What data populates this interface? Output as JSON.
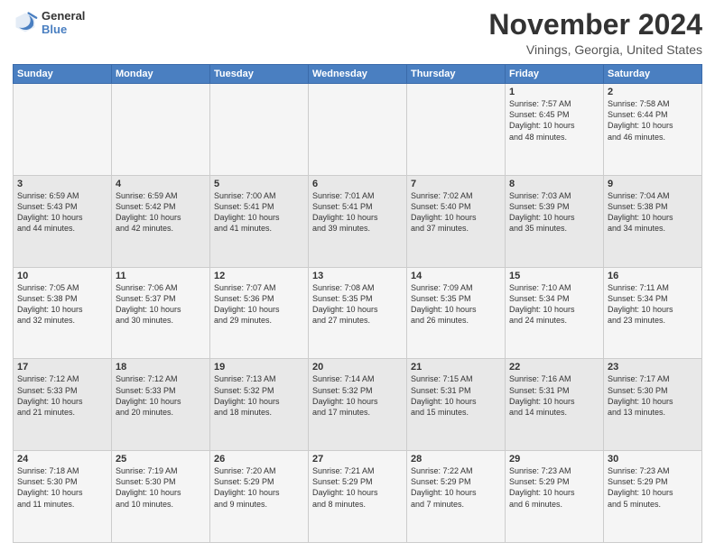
{
  "header": {
    "logo_general": "General",
    "logo_blue": "Blue",
    "month": "November 2024",
    "location": "Vinings, Georgia, United States"
  },
  "days_of_week": [
    "Sunday",
    "Monday",
    "Tuesday",
    "Wednesday",
    "Thursday",
    "Friday",
    "Saturday"
  ],
  "weeks": [
    [
      {
        "day": "",
        "info": ""
      },
      {
        "day": "",
        "info": ""
      },
      {
        "day": "",
        "info": ""
      },
      {
        "day": "",
        "info": ""
      },
      {
        "day": "",
        "info": ""
      },
      {
        "day": "1",
        "info": "Sunrise: 7:57 AM\nSunset: 6:45 PM\nDaylight: 10 hours\nand 48 minutes."
      },
      {
        "day": "2",
        "info": "Sunrise: 7:58 AM\nSunset: 6:44 PM\nDaylight: 10 hours\nand 46 minutes."
      }
    ],
    [
      {
        "day": "3",
        "info": "Sunrise: 6:59 AM\nSunset: 5:43 PM\nDaylight: 10 hours\nand 44 minutes."
      },
      {
        "day": "4",
        "info": "Sunrise: 6:59 AM\nSunset: 5:42 PM\nDaylight: 10 hours\nand 42 minutes."
      },
      {
        "day": "5",
        "info": "Sunrise: 7:00 AM\nSunset: 5:41 PM\nDaylight: 10 hours\nand 41 minutes."
      },
      {
        "day": "6",
        "info": "Sunrise: 7:01 AM\nSunset: 5:41 PM\nDaylight: 10 hours\nand 39 minutes."
      },
      {
        "day": "7",
        "info": "Sunrise: 7:02 AM\nSunset: 5:40 PM\nDaylight: 10 hours\nand 37 minutes."
      },
      {
        "day": "8",
        "info": "Sunrise: 7:03 AM\nSunset: 5:39 PM\nDaylight: 10 hours\nand 35 minutes."
      },
      {
        "day": "9",
        "info": "Sunrise: 7:04 AM\nSunset: 5:38 PM\nDaylight: 10 hours\nand 34 minutes."
      }
    ],
    [
      {
        "day": "10",
        "info": "Sunrise: 7:05 AM\nSunset: 5:38 PM\nDaylight: 10 hours\nand 32 minutes."
      },
      {
        "day": "11",
        "info": "Sunrise: 7:06 AM\nSunset: 5:37 PM\nDaylight: 10 hours\nand 30 minutes."
      },
      {
        "day": "12",
        "info": "Sunrise: 7:07 AM\nSunset: 5:36 PM\nDaylight: 10 hours\nand 29 minutes."
      },
      {
        "day": "13",
        "info": "Sunrise: 7:08 AM\nSunset: 5:35 PM\nDaylight: 10 hours\nand 27 minutes."
      },
      {
        "day": "14",
        "info": "Sunrise: 7:09 AM\nSunset: 5:35 PM\nDaylight: 10 hours\nand 26 minutes."
      },
      {
        "day": "15",
        "info": "Sunrise: 7:10 AM\nSunset: 5:34 PM\nDaylight: 10 hours\nand 24 minutes."
      },
      {
        "day": "16",
        "info": "Sunrise: 7:11 AM\nSunset: 5:34 PM\nDaylight: 10 hours\nand 23 minutes."
      }
    ],
    [
      {
        "day": "17",
        "info": "Sunrise: 7:12 AM\nSunset: 5:33 PM\nDaylight: 10 hours\nand 21 minutes."
      },
      {
        "day": "18",
        "info": "Sunrise: 7:12 AM\nSunset: 5:33 PM\nDaylight: 10 hours\nand 20 minutes."
      },
      {
        "day": "19",
        "info": "Sunrise: 7:13 AM\nSunset: 5:32 PM\nDaylight: 10 hours\nand 18 minutes."
      },
      {
        "day": "20",
        "info": "Sunrise: 7:14 AM\nSunset: 5:32 PM\nDaylight: 10 hours\nand 17 minutes."
      },
      {
        "day": "21",
        "info": "Sunrise: 7:15 AM\nSunset: 5:31 PM\nDaylight: 10 hours\nand 15 minutes."
      },
      {
        "day": "22",
        "info": "Sunrise: 7:16 AM\nSunset: 5:31 PM\nDaylight: 10 hours\nand 14 minutes."
      },
      {
        "day": "23",
        "info": "Sunrise: 7:17 AM\nSunset: 5:30 PM\nDaylight: 10 hours\nand 13 minutes."
      }
    ],
    [
      {
        "day": "24",
        "info": "Sunrise: 7:18 AM\nSunset: 5:30 PM\nDaylight: 10 hours\nand 11 minutes."
      },
      {
        "day": "25",
        "info": "Sunrise: 7:19 AM\nSunset: 5:30 PM\nDaylight: 10 hours\nand 10 minutes."
      },
      {
        "day": "26",
        "info": "Sunrise: 7:20 AM\nSunset: 5:29 PM\nDaylight: 10 hours\nand 9 minutes."
      },
      {
        "day": "27",
        "info": "Sunrise: 7:21 AM\nSunset: 5:29 PM\nDaylight: 10 hours\nand 8 minutes."
      },
      {
        "day": "28",
        "info": "Sunrise: 7:22 AM\nSunset: 5:29 PM\nDaylight: 10 hours\nand 7 minutes."
      },
      {
        "day": "29",
        "info": "Sunrise: 7:23 AM\nSunset: 5:29 PM\nDaylight: 10 hours\nand 6 minutes."
      },
      {
        "day": "30",
        "info": "Sunrise: 7:23 AM\nSunset: 5:29 PM\nDaylight: 10 hours\nand 5 minutes."
      }
    ]
  ]
}
